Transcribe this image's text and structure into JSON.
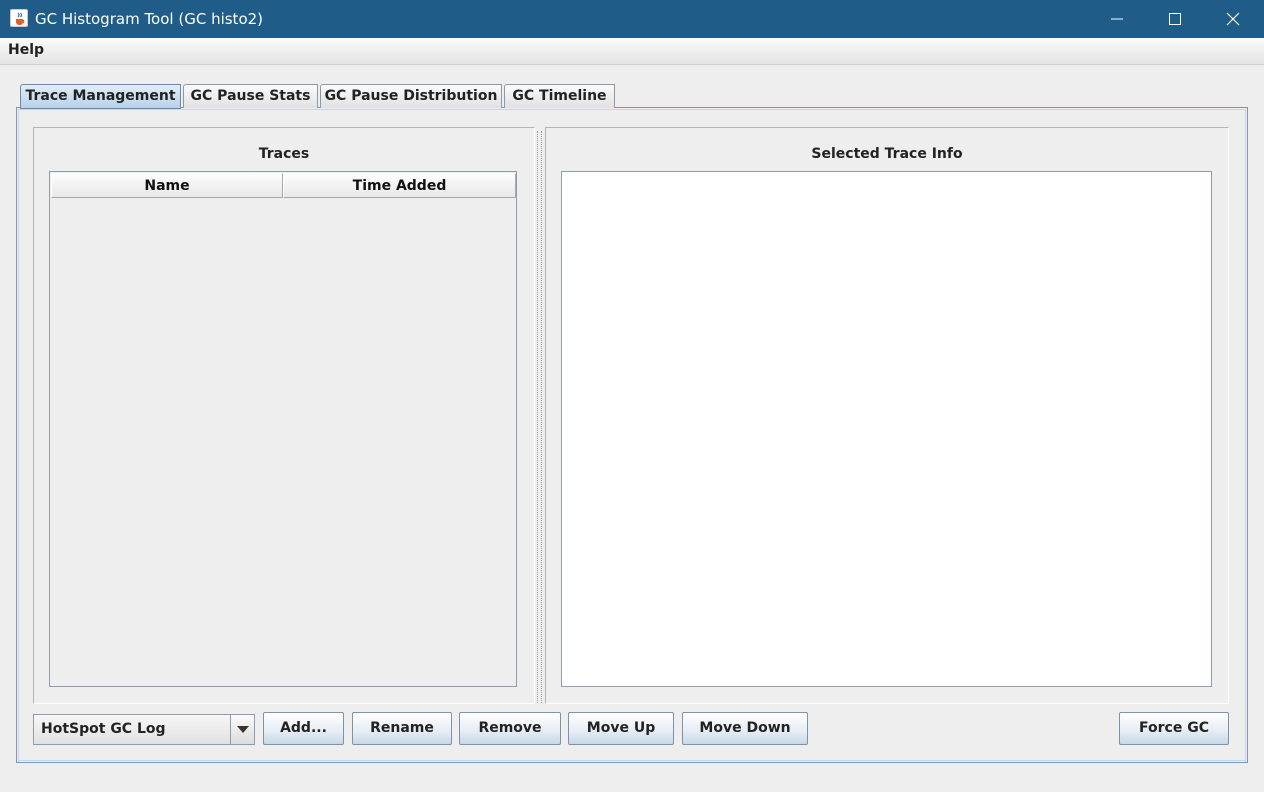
{
  "window": {
    "title": "GC Histogram Tool (GC histo2)",
    "app_icon": "java-cup-icon",
    "controls": [
      "minimize-icon",
      "maximize-icon",
      "close-icon"
    ]
  },
  "menu": {
    "items": [
      "Help"
    ]
  },
  "tabs": [
    {
      "label": "Trace Management",
      "active": true
    },
    {
      "label": "GC Pause Stats",
      "active": false
    },
    {
      "label": "GC Pause Distribution",
      "active": false
    },
    {
      "label": "GC Timeline",
      "active": false
    }
  ],
  "traces_panel": {
    "title": "Traces",
    "columns": [
      "Name",
      "Time Added"
    ],
    "rows": []
  },
  "info_panel": {
    "title": "Selected Trace Info",
    "content": ""
  },
  "controls": {
    "trace_type": "HotSpot GC Log",
    "add_label": "Add...",
    "rename_label": "Rename",
    "remove_label": "Remove",
    "move_up_label": "Move Up",
    "move_down_label": "Move Down",
    "force_gc_label": "Force GC"
  },
  "colors": {
    "titlebar": "#1f5c88",
    "background": "#eeeeee",
    "active_tab": "#b8d1ea"
  }
}
